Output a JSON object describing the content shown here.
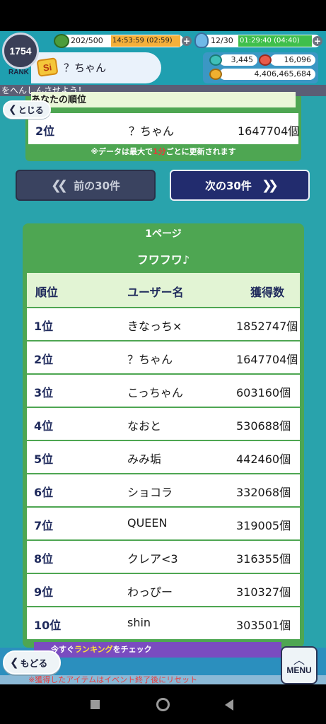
{
  "header": {
    "rank_value": "1754",
    "rank_label": "RANK",
    "badge": "Si",
    "player_name": "？ちゃん",
    "stamina": "202/500",
    "stamina_timer": "14:53:59 (02:59)",
    "potion": "12/30",
    "potion_timer": "01:29:40 (04:40)",
    "currency_1": "3,445",
    "currency_2": "16,096",
    "currency_3": "4,406,465,684",
    "plus": "+"
  },
  "marquee": "をへんしんさせよう！",
  "close_label": "とじる",
  "my_rank": {
    "title": "あなたの順位",
    "rank": "2位",
    "name": "？ちゃん",
    "score": "1647704個",
    "notice_pre": "※データは最大で",
    "notice_em": "1分",
    "notice_post": "ごとに更新されます"
  },
  "pager": {
    "prev": "前の30件",
    "next": "次の30件"
  },
  "ranking": {
    "page_label": "1ページ",
    "title": "フワフワ♪",
    "headers": {
      "rank": "順位",
      "user": "ユーザー名",
      "score": "獲得数"
    },
    "rows": [
      {
        "rank": "1位",
        "name": "きなっち×",
        "score": "1852747個"
      },
      {
        "rank": "2位",
        "name": "？ちゃん",
        "score": "1647704個"
      },
      {
        "rank": "3位",
        "name": "こっちゃん",
        "score": "603160個"
      },
      {
        "rank": "4位",
        "name": "なおと",
        "score": "530688個"
      },
      {
        "rank": "5位",
        "name": "みみ垢",
        "score": "442460個"
      },
      {
        "rank": "6位",
        "name": "ショコラ",
        "score": "332068個"
      },
      {
        "rank": "7位",
        "name": "QUEEN",
        "score": "319005個"
      },
      {
        "rank": "8位",
        "name": "クレア<3",
        "score": "316355個"
      },
      {
        "rank": "9位",
        "name": "わっぴー",
        "score": "310327個"
      },
      {
        "rank": "10位",
        "name": "shin",
        "score": "303501個"
      }
    ]
  },
  "bottom": {
    "banner_pre": "今すぐ",
    "banner_em": "ランキング",
    "banner_post": "をチェック",
    "back_label": "もどる",
    "menu_label": "MENU",
    "footnote": "※獲得したアイテムはイベント終了後にリセット"
  }
}
